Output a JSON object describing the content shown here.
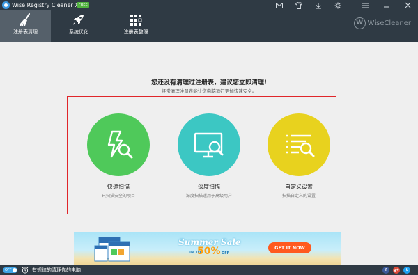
{
  "app": {
    "title": "Wise Registry Cleaner X",
    "badge": "FREE"
  },
  "titlebar_icons": [
    "mail-icon",
    "shirt-icon",
    "download-icon",
    "settings-icon",
    "menu-icon",
    "minimize-icon",
    "close-icon"
  ],
  "nav": {
    "tabs": [
      {
        "label": "注册表清理",
        "icon": "broom-icon",
        "active": true
      },
      {
        "label": "系统优化",
        "icon": "rocket-icon",
        "active": false
      },
      {
        "label": "注册表整理",
        "icon": "blocks-icon",
        "active": false
      }
    ],
    "brand_letter": "W",
    "brand_text": "WiseCleaner"
  },
  "main": {
    "heading": "您还没有清理过注册表，建议您立即清理!",
    "subheading": "经常清理注册表能让您电脑运行更加快速安全。",
    "options": [
      {
        "title": "快速扫描",
        "desc": "只扫描安全的项目",
        "icon": "bolt-search-icon",
        "color": "#4fc95a"
      },
      {
        "title": "深度扫描",
        "desc": "深度扫描适用于高级用户",
        "icon": "monitor-search-icon",
        "color": "#3cc7c3"
      },
      {
        "title": "自定义设置",
        "desc": "扫描自定义的设置",
        "icon": "list-search-icon",
        "color": "#e8d21e"
      }
    ]
  },
  "banner": {
    "title": "Summer Sale",
    "up_to": "UP TO",
    "percent": "50%",
    "off": "OFF",
    "cta": "GET IT NOW"
  },
  "statusbar": {
    "toggle_label": "OFF",
    "text": "有规律的清理你的电脑",
    "social": [
      {
        "name": "facebook-icon",
        "label": "f",
        "color": "#3b5998"
      },
      {
        "name": "gplus-icon",
        "label": "g+",
        "color": "#dd4b39"
      },
      {
        "name": "twitter-icon",
        "label": "t",
        "color": "#1da1f2"
      }
    ]
  },
  "colors": {
    "chrome": "#2f3a44",
    "active_tab": "#55606a",
    "highlight": "#e0262a"
  }
}
